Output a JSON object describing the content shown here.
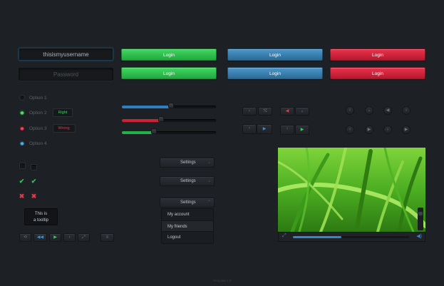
{
  "login_form": {
    "username_value": "thisismyusername",
    "password_placeholder": "Password"
  },
  "buttons": {
    "login_label": "Login"
  },
  "radios": [
    {
      "label": "Option 1",
      "state": "off"
    },
    {
      "label": "Option 2",
      "state": "green",
      "tag": "Right"
    },
    {
      "label": "Option 3",
      "state": "red",
      "tag": "Wrong"
    },
    {
      "label": "Option 4",
      "state": "blue"
    }
  ],
  "tooltip": {
    "line1": "This is",
    "line2": "a tooltip"
  },
  "sliders": [
    {
      "color": "#2f7fc0",
      "value": 0.52
    },
    {
      "color": "#d21f38",
      "value": 0.42
    },
    {
      "color": "#23b14a",
      "value": 0.34
    }
  ],
  "dropdowns": {
    "label": "Settings",
    "menu_items": [
      "My account",
      "My friends",
      "Logout"
    ]
  },
  "video": {
    "progress": 0.42
  },
  "footer": {
    "text": "Template 1.0"
  },
  "colors": {
    "green": "#2fc655",
    "blue": "#3a86c0",
    "red": "#d21f38",
    "background": "#1d2024"
  }
}
